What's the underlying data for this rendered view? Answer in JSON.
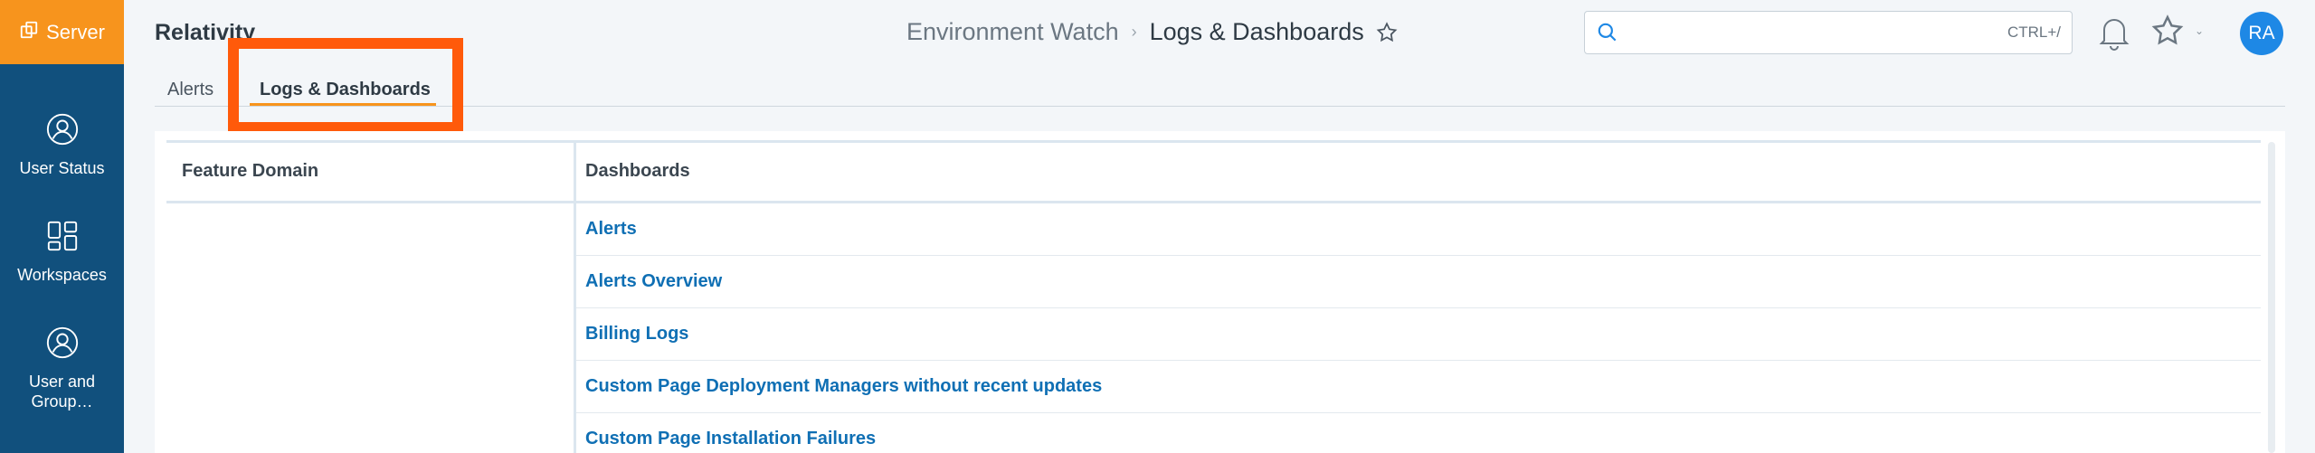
{
  "sidebar": {
    "brand": "Server",
    "items": [
      {
        "label": "User Status",
        "icon": "user-circle-icon"
      },
      {
        "label": "Workspaces",
        "icon": "grid-icon"
      },
      {
        "label": "User and Group…",
        "icon": "user-circle-icon"
      }
    ]
  },
  "header": {
    "app_title": "Relativity",
    "breadcrumb": [
      "Environment Watch",
      "Logs & Dashboards"
    ],
    "search": {
      "placeholder": "",
      "shortcut": "CTRL+/"
    },
    "avatar_initials": "RA"
  },
  "tabs": [
    {
      "label": "Alerts",
      "active": false
    },
    {
      "label": "Logs & Dashboards",
      "active": true
    }
  ],
  "table": {
    "columns": [
      "Feature Domain",
      "Dashboards"
    ],
    "rows": [
      "Alerts",
      "Alerts Overview",
      "Billing Logs",
      "Custom Page Deployment Managers without recent updates",
      "Custom Page Installation Failures"
    ]
  },
  "colors": {
    "brand": "#f7941d",
    "sidebar": "#11507d",
    "link": "#0f6fb4",
    "highlight": "#ff5a0a",
    "avatar": "#1e88e5"
  }
}
